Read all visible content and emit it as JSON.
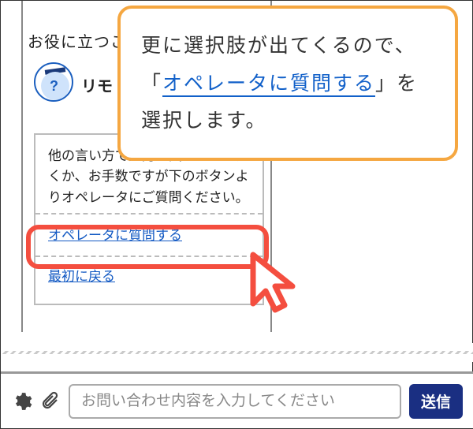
{
  "header": {
    "partial_text": "お役に立つこ"
  },
  "avatar": {
    "label": "リモ"
  },
  "bubble": {
    "text": "他の言い方で入力を試していただくか、お手数ですが下のボタンよりオペレータにご質問ください。",
    "options": [
      {
        "label": "オペレータに質問する"
      },
      {
        "label": "最初に戻る"
      }
    ]
  },
  "tooltip": {
    "pre": "更に選択肢が出てくるので、「",
    "emph": "オペレータに質問する",
    "post": "」を選択します。"
  },
  "input": {
    "placeholder": "お問い合わせ内容を入力してください",
    "send_label": "送信"
  }
}
